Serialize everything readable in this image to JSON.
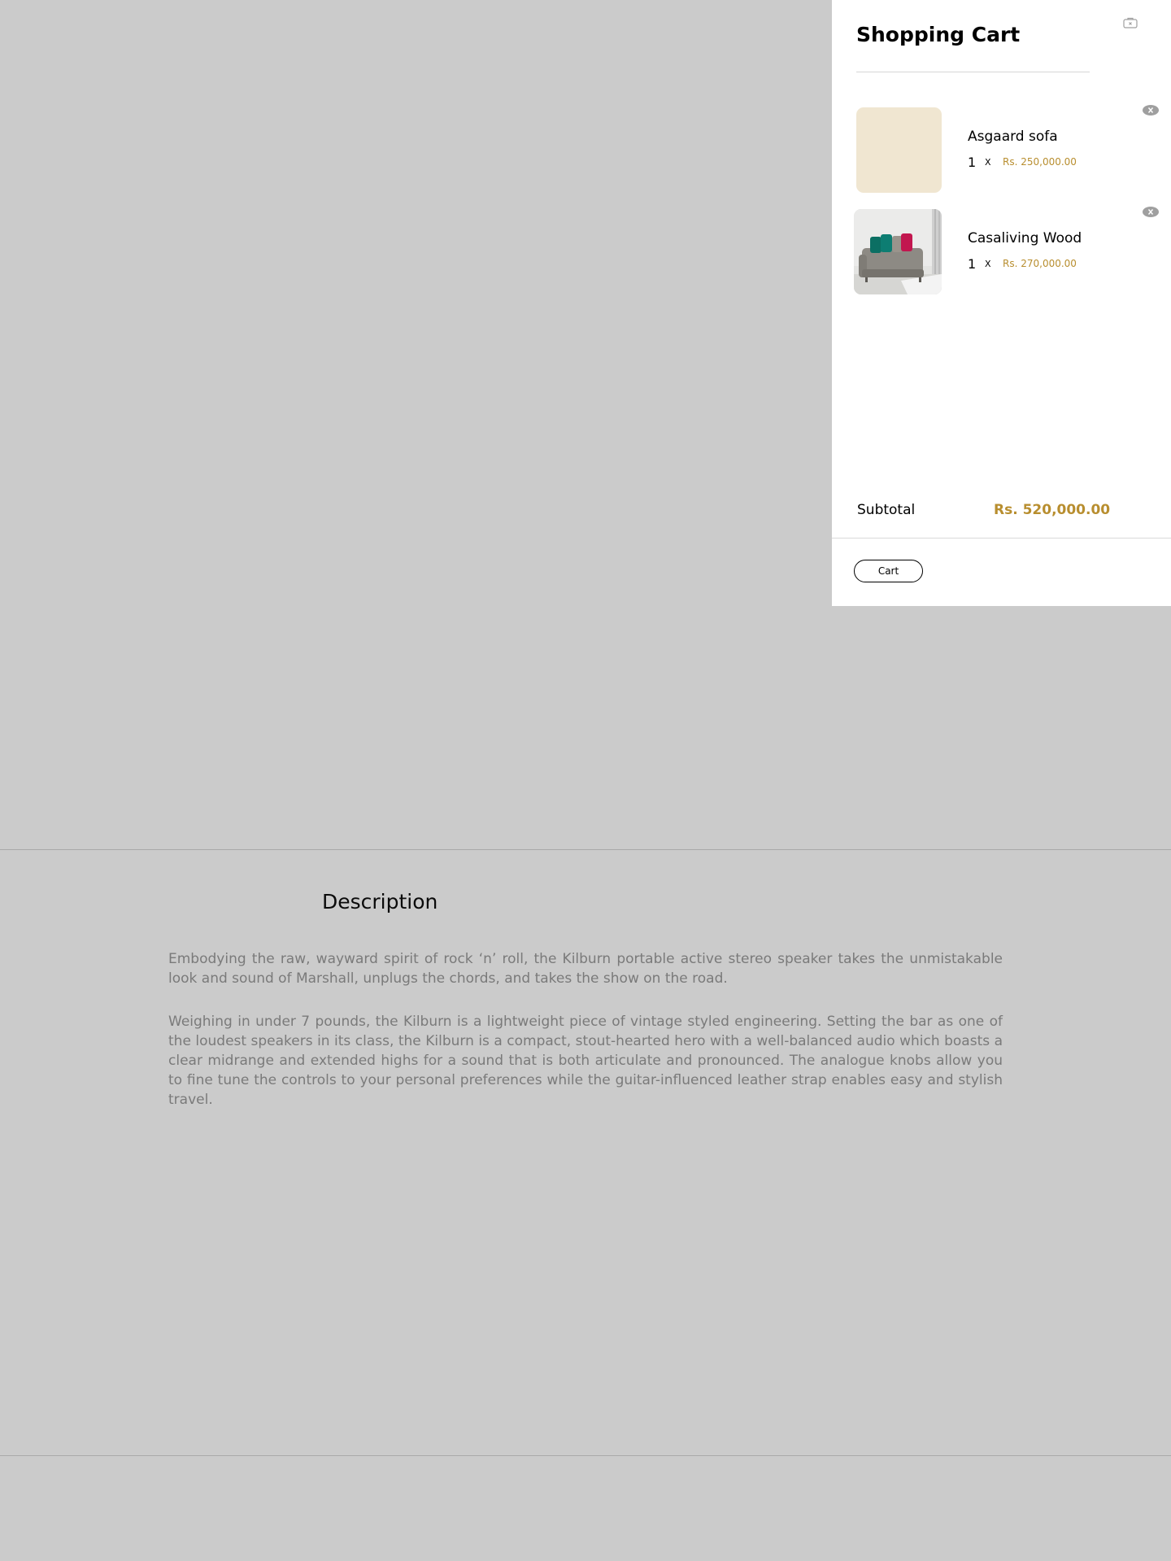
{
  "cart": {
    "title": "Shopping Cart",
    "items": [
      {
        "name": "Asgaard sofa",
        "quantity": "1",
        "times": "X",
        "price": "Rs. 250,000.00"
      },
      {
        "name": "Casaliving Wood",
        "quantity": "1",
        "times": "X",
        "price": "Rs. 270,000.00"
      }
    ],
    "subtotal_label": "Subtotal",
    "subtotal_value": "Rs. 520,000.00",
    "cart_button_label": "Cart",
    "accent_color": "#b88e2f",
    "close_icon": "bag-close-icon",
    "remove_icon": "remove-circle-icon"
  },
  "description": {
    "title": "Description",
    "paragraphs": [
      "Embodying the raw, wayward spirit of rock ‘n’ roll, the Kilburn portable active stereo speaker takes the unmistakable look and sound of Marshall, unplugs the chords, and takes the show on the road.",
      "Weighing in under 7 pounds, the Kilburn is a lightweight piece of vintage styled engineering. Setting the bar as one of the loudest speakers in its class, the Kilburn is a compact, stout-hearted hero with a well-balanced audio which boasts a clear midrange and extended highs for a sound that is both articulate and pronounced. The analogue knobs allow you to fine tune the controls to your personal preferences while the guitar-influenced leather strap enables easy and stylish travel."
    ]
  },
  "overlay_color": "#cbcbcb"
}
